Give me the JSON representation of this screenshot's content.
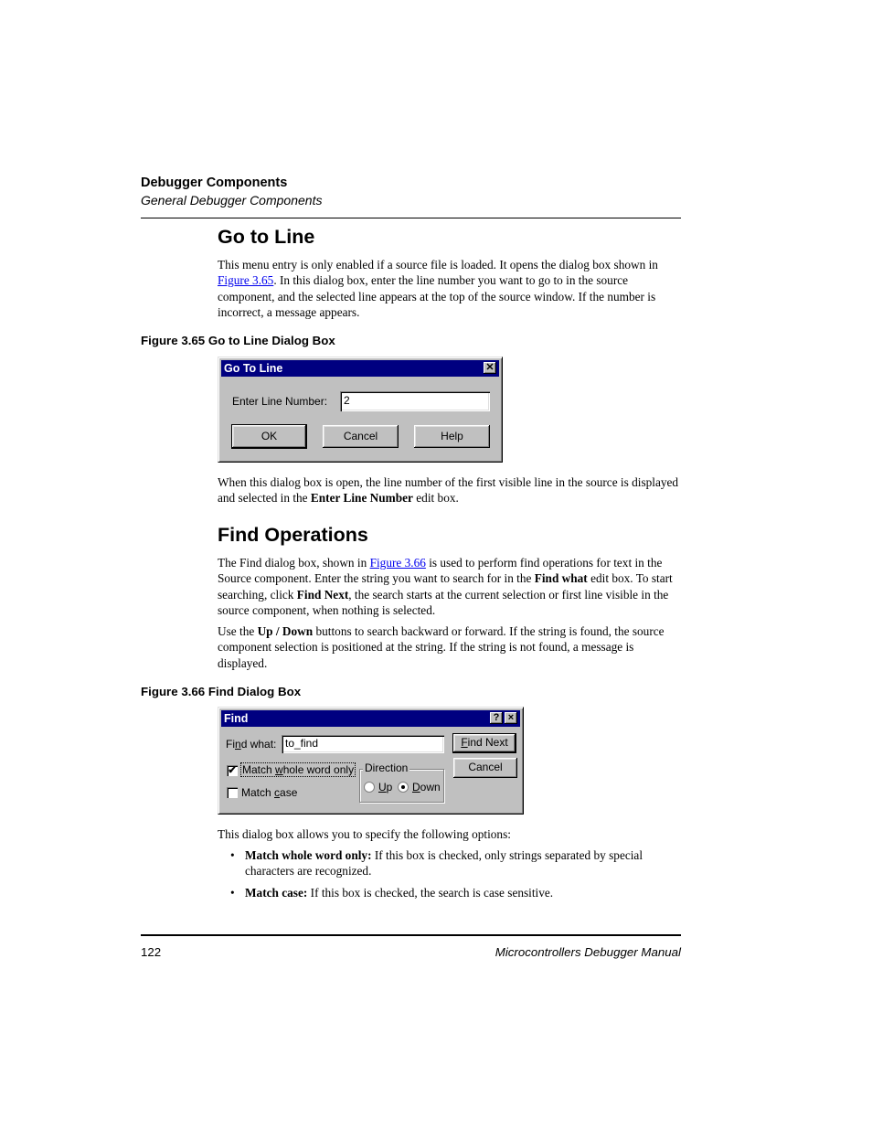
{
  "header": {
    "title": "Debugger Components",
    "subtitle": "General Debugger Components"
  },
  "goto_section": {
    "heading": "Go to Line",
    "para1": {
      "before": "This menu entry is only enabled if a source file is loaded. It opens the dialog box shown in ",
      "link": "Figure 3.65",
      "after": ". In this dialog box, enter the line number you want to go to in the source component, and the selected line appears at the top of the source window. If the number is incorrect, a message appears."
    },
    "figure_caption": "Figure 3.65  Go to Line Dialog Box",
    "dialog": {
      "title": "Go To Line",
      "close_icon": "close-icon",
      "field_label": "Enter Line Number:",
      "field_value": "2",
      "buttons": {
        "ok": "OK",
        "cancel": "Cancel",
        "help": "Help"
      }
    },
    "para2": {
      "before": "When this dialog box is open, the line number of the first visible line in the source is displayed and selected in the ",
      "bold": "Enter Line Number",
      "after": " edit box."
    }
  },
  "find_section": {
    "heading": "Find Operations",
    "para1": {
      "t1": "The Find dialog box, shown in ",
      "link": "Figure 3.66",
      "t2": " is used to perform find operations for text in the Source component. Enter the string you want to search for in the ",
      "b1": "Find what",
      "t3": " edit box. To start searching, click ",
      "b2": "Find Next",
      "t4": ", the search starts at the current selection or first line visible in the source component, when nothing is selected."
    },
    "para2": {
      "t1": "Use the ",
      "b1": "Up / Down",
      "t2": " buttons to search backward or forward. If the string is found, the source component selection is positioned at the string. If the string is not found, a message is displayed."
    },
    "figure_caption": "Figure 3.66  Find Dialog Box",
    "dialog": {
      "title": "Find",
      "help_icon": "?",
      "close_icon": "×",
      "find_label_pre": "Fi",
      "find_label_u": "n",
      "find_label_post": "d what:",
      "find_value": "to_find",
      "find_next_u": "F",
      "find_next_rest": "ind Next",
      "cancel": "Cancel",
      "match_whole_pre": "Match ",
      "match_whole_u": "w",
      "match_whole_post": "hole word only",
      "match_whole_checked": true,
      "match_case_pre": "Match ",
      "match_case_u": "c",
      "match_case_post": "ase",
      "match_case_checked": false,
      "direction_label": "Direction",
      "up_u": "U",
      "up_rest": "p",
      "down_u": "D",
      "down_rest": "own",
      "direction_selected": "Down",
      "check_mark": "✔"
    },
    "para3": "This dialog box allows you to specify the following options:",
    "bullets": [
      {
        "bold": "Match whole word only:",
        "text": " If this box is checked, only strings separated by special characters are recognized."
      },
      {
        "bold": "Match case:",
        "text": " If this box is checked, the search is case sensitive."
      }
    ],
    "bullet_glyph": "•"
  },
  "footer": {
    "page_number": "122",
    "manual_title": "Microcontrollers Debugger Manual"
  }
}
